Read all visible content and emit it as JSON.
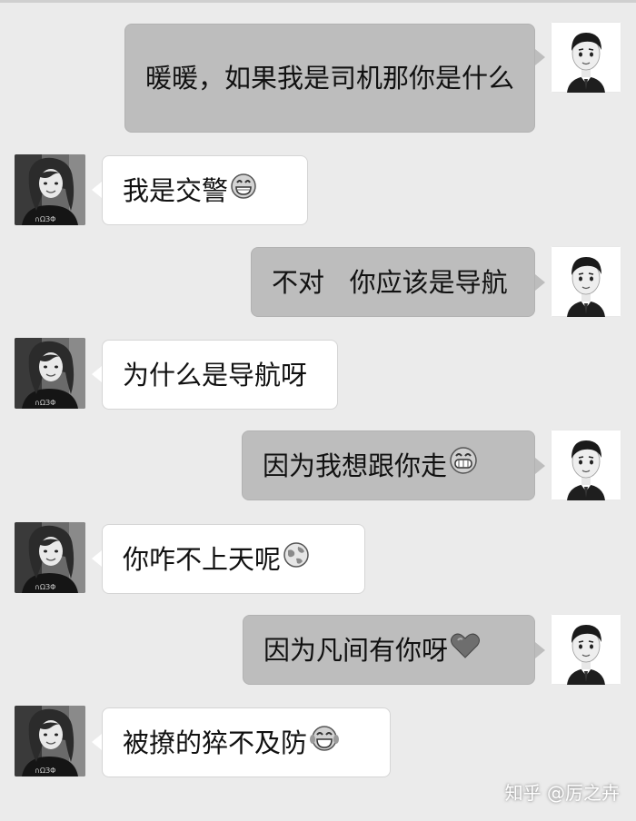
{
  "messages": [
    {
      "side": "out",
      "text": "暖暖，如果我是司机那你是什么",
      "emoji": ""
    },
    {
      "side": "in",
      "text": "我是交警",
      "emoji": "grin-emoji"
    },
    {
      "side": "out",
      "text": "不对   你应该是导航",
      "emoji": ""
    },
    {
      "side": "in",
      "text": "为什么是导航呀",
      "emoji": ""
    },
    {
      "side": "out",
      "text": "因为我想跟你走",
      "emoji": "grin-teeth-emoji"
    },
    {
      "side": "in",
      "text": "你咋不上天呢",
      "emoji": "globe-emoji"
    },
    {
      "side": "out",
      "text": "因为凡间有你呀",
      "emoji": "heart-emoji"
    },
    {
      "side": "in",
      "text": "被撩的猝不及防",
      "emoji": "tears-of-joy-emoji"
    }
  ],
  "watermark": "知乎 @厉之卉",
  "colors": {
    "background": "#ebebeb",
    "outgoing_bubble": "#bdbdbd",
    "incoming_bubble": "#ffffff"
  }
}
